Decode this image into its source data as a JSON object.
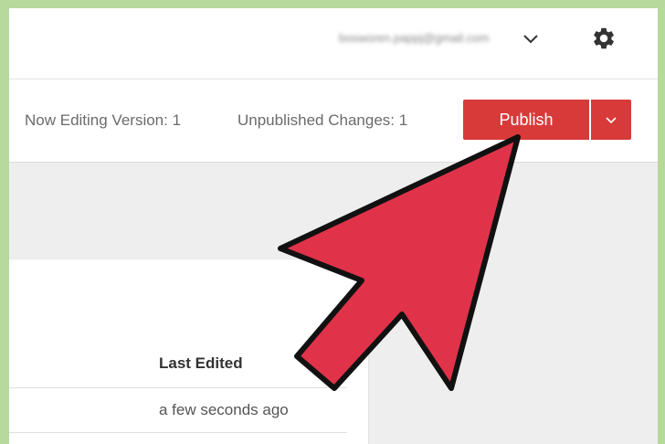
{
  "header": {
    "account_email": "bosworen.pappj@gmail.com",
    "account_chevron_icon": "chevron-down-icon",
    "settings_icon": "gear-icon"
  },
  "toolbar": {
    "version_label": "Now Editing Version: 1",
    "changes_label": "Unpublished Changes: 1",
    "publish_label": "Publish",
    "publish_dropdown_icon": "chevron-down-icon"
  },
  "table": {
    "columns": [
      "Last Edited"
    ],
    "rows": [
      {
        "last_edited": "a few seconds ago"
      }
    ]
  },
  "colors": {
    "frame_border": "#b7d99b",
    "publish_button": "#d83a39",
    "arrow_fill": "#e0334a",
    "arrow_stroke": "#111111"
  },
  "annotation": {
    "arrow_icon": "pointer-arrow-icon"
  }
}
